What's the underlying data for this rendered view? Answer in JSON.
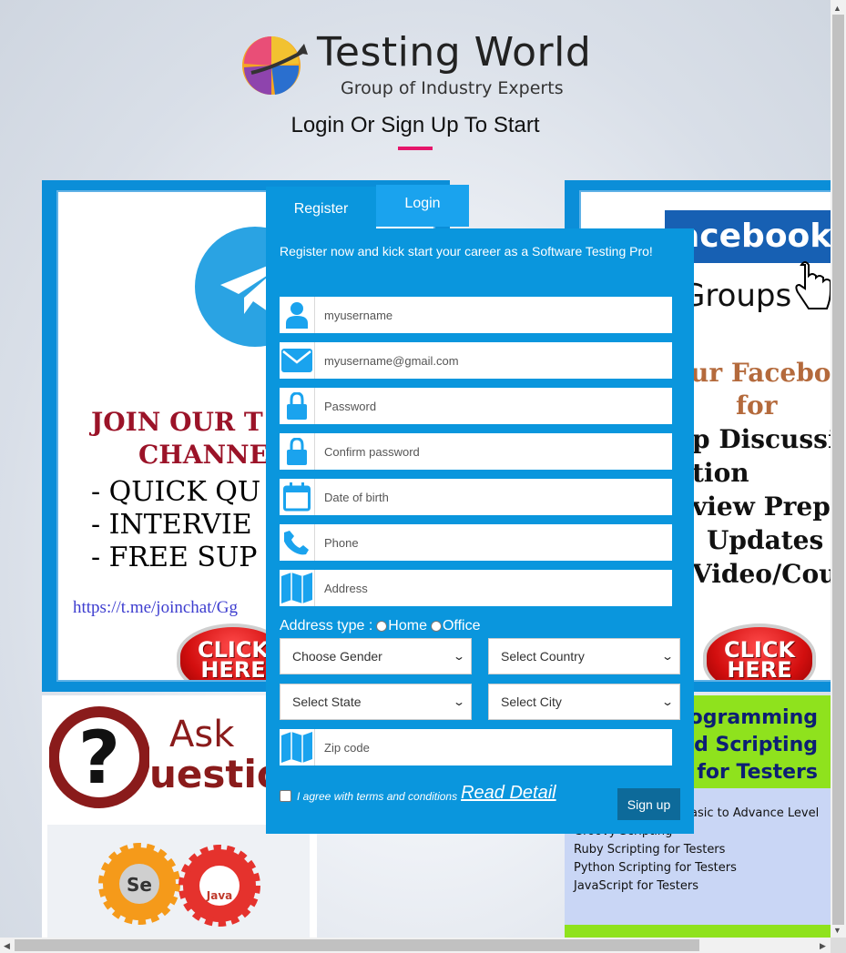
{
  "header": {
    "logo_title": "Testing World",
    "logo_subtitle": "Group of Industry Experts",
    "tagline": "Login Or Sign Up To Start"
  },
  "promo_left": {
    "heading_line1": "JOIN OUR T",
    "heading_line2": "CHANNE",
    "bullets": [
      "- QUICK QU",
      "- INTERVIE",
      "- FREE SUP"
    ],
    "link": "https://t.me/joinchat/Gg",
    "click_label_top": "CLICK",
    "click_label_bottom": "HERE"
  },
  "promo_right": {
    "facebook": "acebook",
    "groups": "Groups",
    "lines": [
      "ur Facebook",
      "for",
      "p Discussio",
      "tion",
      "view Prep",
      "Updates",
      "Video/Cou"
    ],
    "click_label_top": "CLICK",
    "click_label_bottom": "HERE"
  },
  "ask": {
    "line1": "Ask",
    "line2": "uestio",
    "gear1": "Se",
    "gear2": "Java"
  },
  "programming": {
    "head_lines": [
      "rogramming",
      "nd Scripting",
      "for Testers"
    ],
    "items": [
      "asic to Advance Level",
      "Groovy Scripting",
      "Ruby Scripting for Testers",
      "Python Scripting for Testers",
      "JavaScript for Testers"
    ]
  },
  "tabs": {
    "register": "Register",
    "login": "Login"
  },
  "form": {
    "intro": "Register now and kick start your career as a Software Testing Pro!",
    "fields": [
      {
        "placeholder": "myusername",
        "icon": "user-icon"
      },
      {
        "placeholder": "myusername@gmail.com",
        "icon": "envelope-icon"
      },
      {
        "placeholder": "Password",
        "icon": "lock-icon"
      },
      {
        "placeholder": "Confirm password",
        "icon": "lock-icon"
      },
      {
        "placeholder": "Date of birth",
        "icon": "calendar-icon"
      },
      {
        "placeholder": "Phone",
        "icon": "phone-icon"
      },
      {
        "placeholder": "Address",
        "icon": "map-icon"
      }
    ],
    "address_type_label": "Address type :",
    "address_home": "Home",
    "address_office": "Office",
    "gender": "Choose Gender",
    "country": "Select Country",
    "state": "Select State",
    "city": "Select City",
    "zip_placeholder": "Zip code",
    "terms": "I agree with terms and conditions",
    "read_detail": "Read Detail",
    "signup": "Sign up"
  },
  "colors": {
    "form_blue": "#0a96dd",
    "login_tab": "#1aa3ee",
    "signup_btn": "#0d6a9a",
    "accent_pink": "#e5166b",
    "icon_blue": "#1aa3ee"
  }
}
